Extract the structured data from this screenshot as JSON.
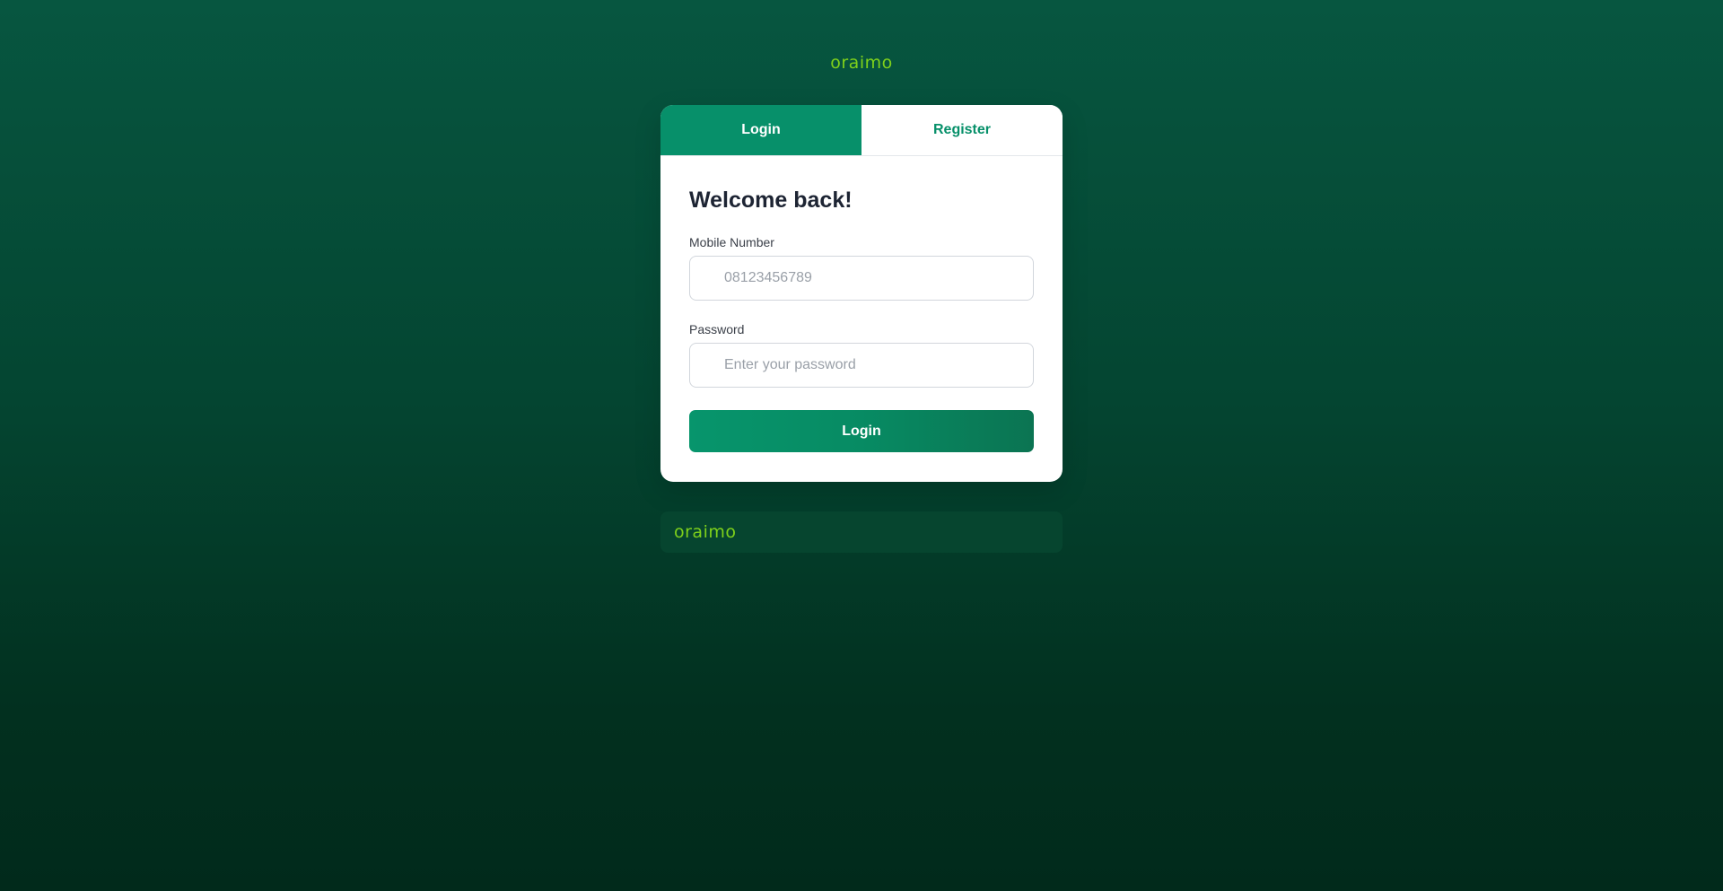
{
  "brand": {
    "top_logo": "oraimo",
    "footer_logo": "oraimo"
  },
  "tabs": [
    {
      "label": "Login",
      "active": true
    },
    {
      "label": "Register",
      "active": false
    }
  ],
  "form": {
    "title": "Welcome back!",
    "mobile_label": "Mobile Number",
    "mobile_placeholder": "08123456789",
    "mobile_value": "",
    "password_label": "Password",
    "password_placeholder": "Enter your password",
    "password_value": "",
    "submit_label": "Login"
  },
  "colors": {
    "brand_green": "#07906a",
    "logo_green": "#7fd11b",
    "background_top": "#075640",
    "background_bottom": "#012a1b"
  }
}
